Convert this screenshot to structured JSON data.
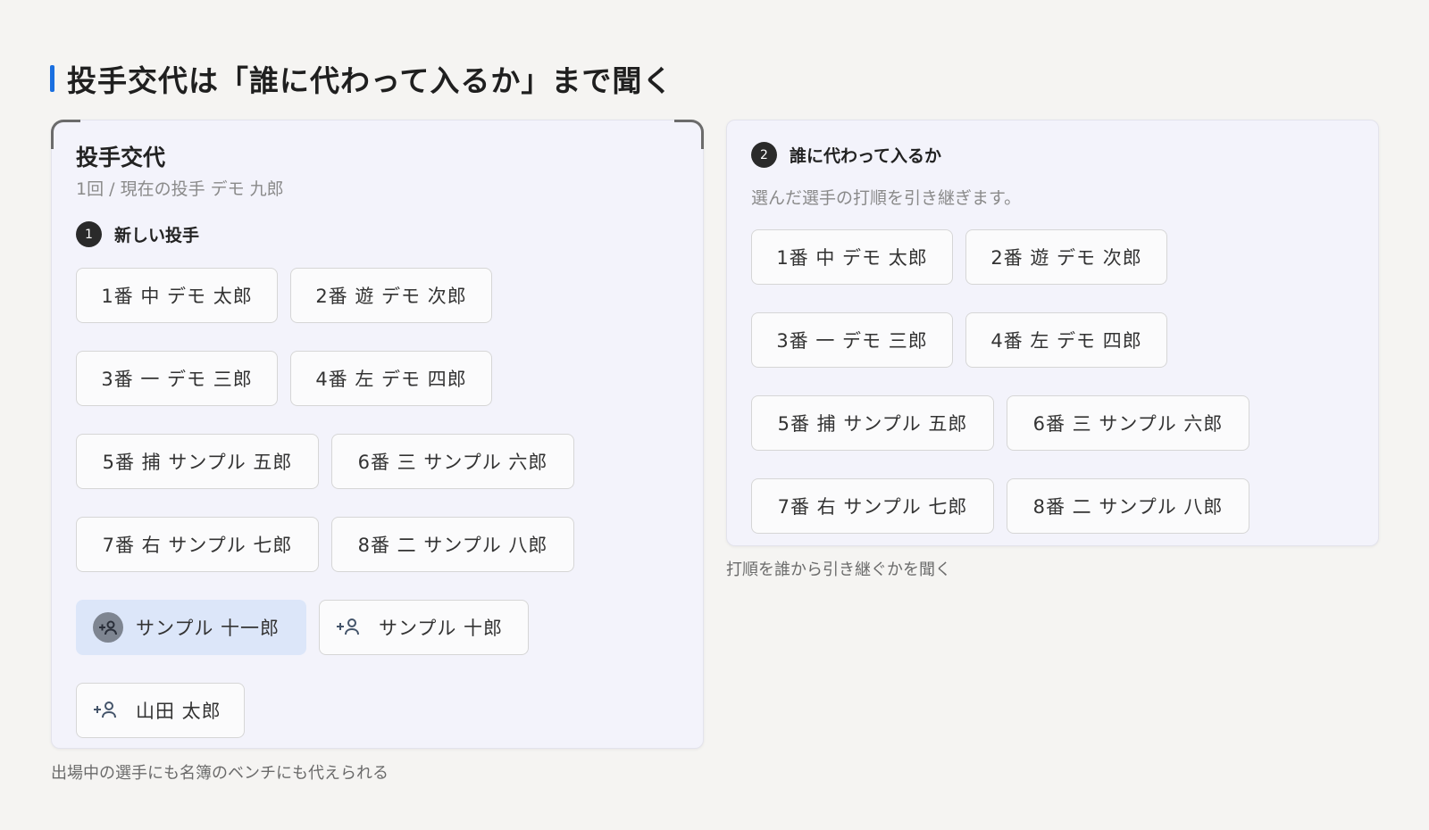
{
  "page": {
    "title": "投手交代は「誰に代わって入るか」まで聞く"
  },
  "left": {
    "title": "投手交代",
    "subtitle": "1回 / 現在の投手 デモ 九郎",
    "step_num": "1",
    "step_label": "新しい投手",
    "players": [
      "1番 中 デモ 太郎",
      "2番 遊 デモ 次郎",
      "3番 一 デモ 三郎",
      "4番 左 デモ 四郎",
      "5番 捕 サンプル 五郎",
      "6番 三 サンプル 六郎",
      "7番 右 サンプル 七郎",
      "8番 二 サンプル 八郎"
    ],
    "bench": [
      "サンプル 十一郎",
      "サンプル 十郎",
      "山田 太郎"
    ],
    "caption": "出場中の選手にも名簿のベンチにも代えられる"
  },
  "right": {
    "step_num": "2",
    "step_label": "誰に代わって入るか",
    "description": "選んだ選手の打順を引き継ぎます。",
    "players": [
      "1番 中 デモ 太郎",
      "2番 遊 デモ 次郎",
      "3番 一 デモ 三郎",
      "4番 左 デモ 四郎",
      "5番 捕 サンプル 五郎",
      "6番 三 サンプル 六郎",
      "7番 右 サンプル 七郎",
      "8番 二 サンプル 八郎"
    ],
    "caption": "打順を誰から引き継ぐかを聞く"
  },
  "colors": {
    "accent": "#1a6fe0",
    "selected_chip": "#dce6f9",
    "card_bg": "#f3f3fb"
  },
  "icons": {
    "add_person": "person-add-icon"
  }
}
